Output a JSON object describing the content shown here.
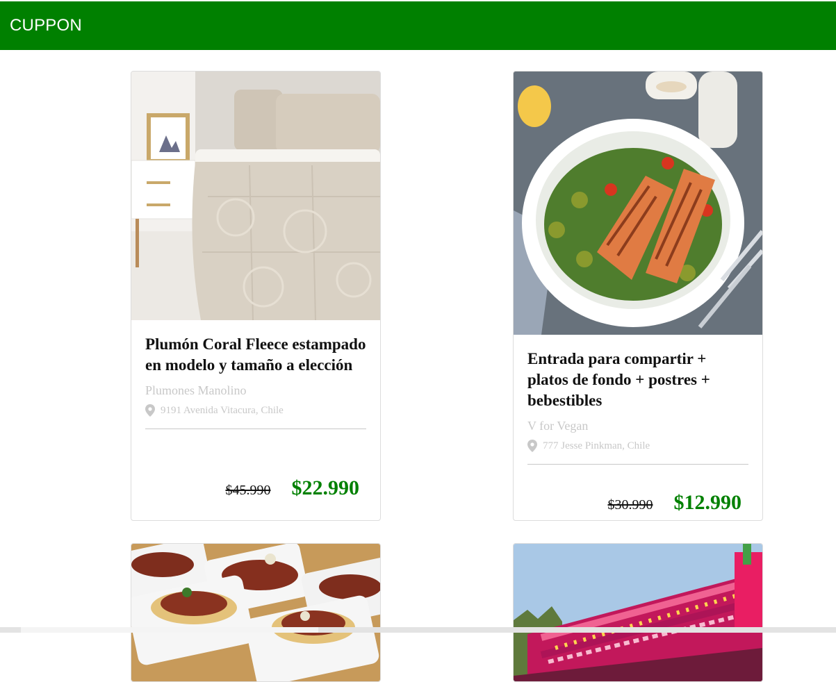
{
  "header": {
    "brand": "CUPPON",
    "color": "#008000"
  },
  "deals": [
    {
      "title": "Plumón Coral Fleece estampado en modelo y tamaño a elección",
      "merchant": "Plumones Manolino",
      "address": "9191 Avenida Vitacura, Chile",
      "original_price": "$45.990",
      "price": "$22.990",
      "image": "bedding-photo"
    },
    {
      "title": "Entrada para compartir + platos de fondo + postres + bebestibles",
      "merchant": "V for Vegan",
      "address": "777 Jesse Pinkman, Chile",
      "original_price": "$30.990",
      "price": "$12.990",
      "image": "salmon-salad-photo"
    },
    {
      "image": "spaghetti-trays-photo"
    },
    {
      "image": "amusement-ride-photo"
    }
  ],
  "icons": {
    "location": "map-pin-icon"
  },
  "colors": {
    "price": "#008000",
    "muted_text": "#c8c8c8"
  }
}
